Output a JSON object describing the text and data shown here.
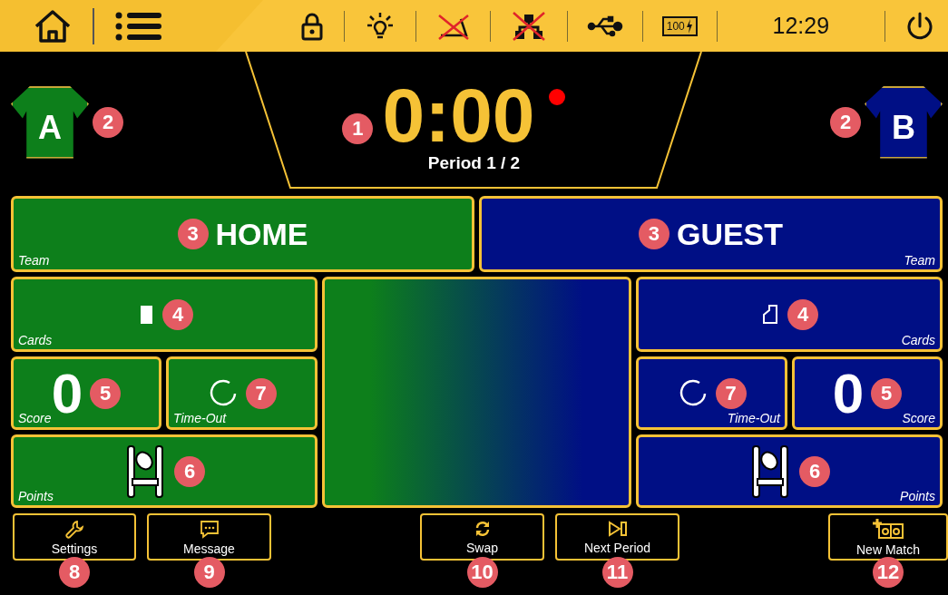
{
  "status_bar": {
    "battery": "100",
    "clock": "12:29"
  },
  "timer": {
    "time": "0:00",
    "period": "Period 1 / 2",
    "callout": "1"
  },
  "teams": [
    {
      "kind": "home",
      "jersey": "A",
      "name": "HOME",
      "name_label": "Team",
      "cards_label": "Cards",
      "score": "0",
      "score_label": "Score",
      "timeout_label": "Time-Out",
      "points_label": "Points",
      "color": "#0d7f1b",
      "callouts": {
        "jersey": "2",
        "team": "3",
        "cards": "4",
        "score": "5",
        "points": "6",
        "timeout": "7"
      }
    },
    {
      "kind": "guest",
      "jersey": "B",
      "name": "GUEST",
      "name_label": "Team",
      "cards_label": "Cards",
      "score": "0",
      "score_label": "Score",
      "timeout_label": "Time-Out",
      "points_label": "Points",
      "color": "#000f85",
      "callouts": {
        "jersey": "2",
        "team": "3",
        "cards": "4",
        "score": "5",
        "points": "6",
        "timeout": "7"
      }
    }
  ],
  "buttons": [
    {
      "kind": "settings",
      "label": "Settings",
      "callout": "8"
    },
    {
      "kind": "message",
      "label": "Message",
      "callout": "9"
    },
    {
      "kind": "swap",
      "label": "Swap",
      "callout": "10"
    },
    {
      "kind": "next",
      "label": "Next Period",
      "callout": "11"
    },
    {
      "kind": "new",
      "label": "New Match",
      "callout": "12"
    }
  ]
}
